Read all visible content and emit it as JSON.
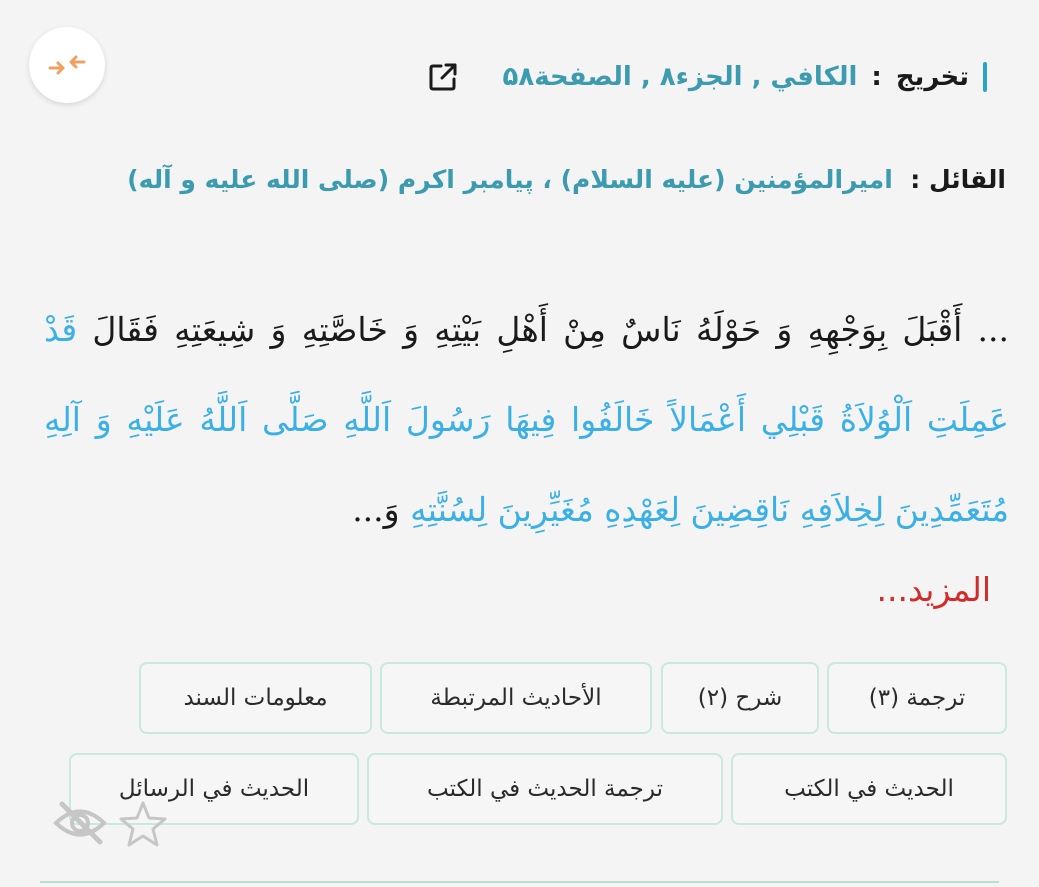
{
  "takhrij": {
    "label": "تخريج",
    "colon": ":",
    "book": "الكافي",
    "sep1": " , ",
    "volume": "الجزء۸",
    "sep2": " , ",
    "page": "الصفحة۵۸"
  },
  "speaker": {
    "label": "القائل",
    "colon": " : ",
    "value": "اميرالمؤمنين (علیه السلام) ، پیامبر اکرم (صلی الله علیه و آله)"
  },
  "hadith": {
    "intro": "... أَقْبَلَ بِوَجْهِهِ وَ حَوْلَهُ نَاسٌ مِنْ أَهْلِ بَيْتِهِ وَ خَاصَّتِهِ وَ شِيعَتِهِ فَقَالَ",
    "quote": "قَدْ عَمِلَتِ اَلْوُلاَةُ قَبْلِي أَعْمَالاً خَالَفُوا فِيهَا رَسُولَ اَللَّهِ صَلَّى اَللَّهُ عَلَيْهِ وَ آلِهِ مُتَعَمِّدِينَ لِخِلاَفِهِ نَاقِضِينَ لِعَهْدِهِ مُغَيِّرِينَ لِسُنَّتِهِ",
    "tail": " وَ..."
  },
  "more_label": "المزيد...",
  "buttons": {
    "translation": "ترجمة (۳)",
    "sharh": "شرح (۲)",
    "related": "الأحاديث المرتبطة",
    "sanad": "معلومات السند",
    "in_books": "الحديث في الكتب",
    "translation_in_books": "ترجمة الحديث في الكتب",
    "in_letters": "الحديث في الرسائل"
  },
  "icons": {
    "collapse": "collapse-arrows-icon",
    "external": "external-link-icon",
    "eye": "eye-off-icon",
    "star": "star-outline-icon"
  },
  "colors": {
    "accent_teal": "#3d9bb0",
    "quote_blue": "#3ab0e6",
    "more_red": "#d22b2b",
    "collapse_orange": "#f0a060",
    "button_border": "#c8e9de"
  }
}
